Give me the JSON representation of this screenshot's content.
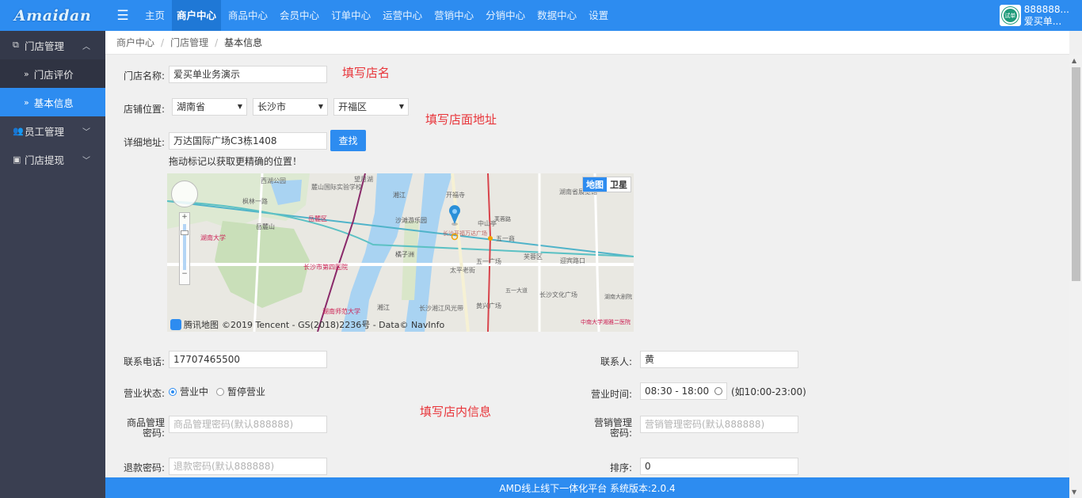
{
  "app": {
    "logo": "Amaidan",
    "menu_icon": "hamburger-icon"
  },
  "nav": {
    "items": [
      "主页",
      "商户中心",
      "商品中心",
      "会员中心",
      "订单中心",
      "运营中心",
      "营销中心",
      "分销中心",
      "数据中心",
      "设置"
    ],
    "active": "商户中心"
  },
  "user": {
    "avatar_text": "试单",
    "id": "888888...",
    "name": "爱买单..."
  },
  "sidebar": {
    "group1": {
      "label": "门店管理",
      "icon": "store-icon"
    },
    "sub1": {
      "label": "门店评价"
    },
    "sub2": {
      "label": "基本信息"
    },
    "group2": {
      "label": "员工管理",
      "icon": "users-icon"
    },
    "group3": {
      "label": "门店提现",
      "icon": "cash-icon"
    }
  },
  "breadcrumb": {
    "l1": "商户中心",
    "l2": "门店管理",
    "l3": "基本信息"
  },
  "form": {
    "store_name_label": "门店名称:",
    "store_name": "爱买单业务演示",
    "note_name": "填写店名",
    "location_label": "店铺位置:",
    "province": "湖南省",
    "city": "长沙市",
    "district": "开福区",
    "note_address": "填写店面地址",
    "address_label": "详细地址:",
    "address": "万达国际广场C3栋1408",
    "search_button": "查找",
    "drag_hint": "拖动标记以获取更精确的位置！",
    "phone_label": "联系电话:",
    "phone": "17707465500",
    "contact_label": "联系人:",
    "contact": "黄",
    "status_label": "营业状态:",
    "status_open": "营业中",
    "status_closed": "暂停营业",
    "hours_label": "营业时间:",
    "hours": "08:30 - 18:00",
    "hours_hint": "(如10:00-23:00)",
    "note_info": "填写店内信息",
    "goods_pwd_label_1": "商品管理",
    "goods_pwd_label_2": "密码:",
    "goods_pwd_placeholder": "商品管理密码(默认888888)",
    "market_pwd_label_1": "营销管理",
    "market_pwd_label_2": "密码:",
    "market_pwd_placeholder": "营销管理密码(默认888888)",
    "refund_label": "退款密码:",
    "refund_placeholder": "退款密码(默认888888)",
    "sort_label": "排序:",
    "sort": "0"
  },
  "map": {
    "tab_map": "地图",
    "tab_satellite": "卫星",
    "brand": "腾讯地图",
    "copyright": "©2019 Tencent - GS(2018)2236号 - Data© NavInfo",
    "labels": [
      "西湖公园",
      "麓山国际实验学校",
      "湘江",
      "望月湖",
      "枫林一路",
      "岳麓区",
      "湖南大学",
      "岳麓山",
      "湘江",
      "橘子洲",
      "沙滩游乐园",
      "芙蓉路",
      "长沙开福万达广场",
      "开福寺",
      "中山亭",
      "五一商",
      "五一广场",
      "太平老街",
      "长沙市第四医院",
      "湖南师范大学",
      "长沙湘江风光带",
      "黄兴广场",
      "长沙文化广场",
      "迎宾路口",
      "湖南省展览馆",
      "湖南大剧院",
      "中南大学湘雅二医院",
      "芙蓉区",
      "五一大道"
    ]
  },
  "footer": {
    "text": "AMD线上线下一体化平台 系统版本:2.0.4"
  }
}
